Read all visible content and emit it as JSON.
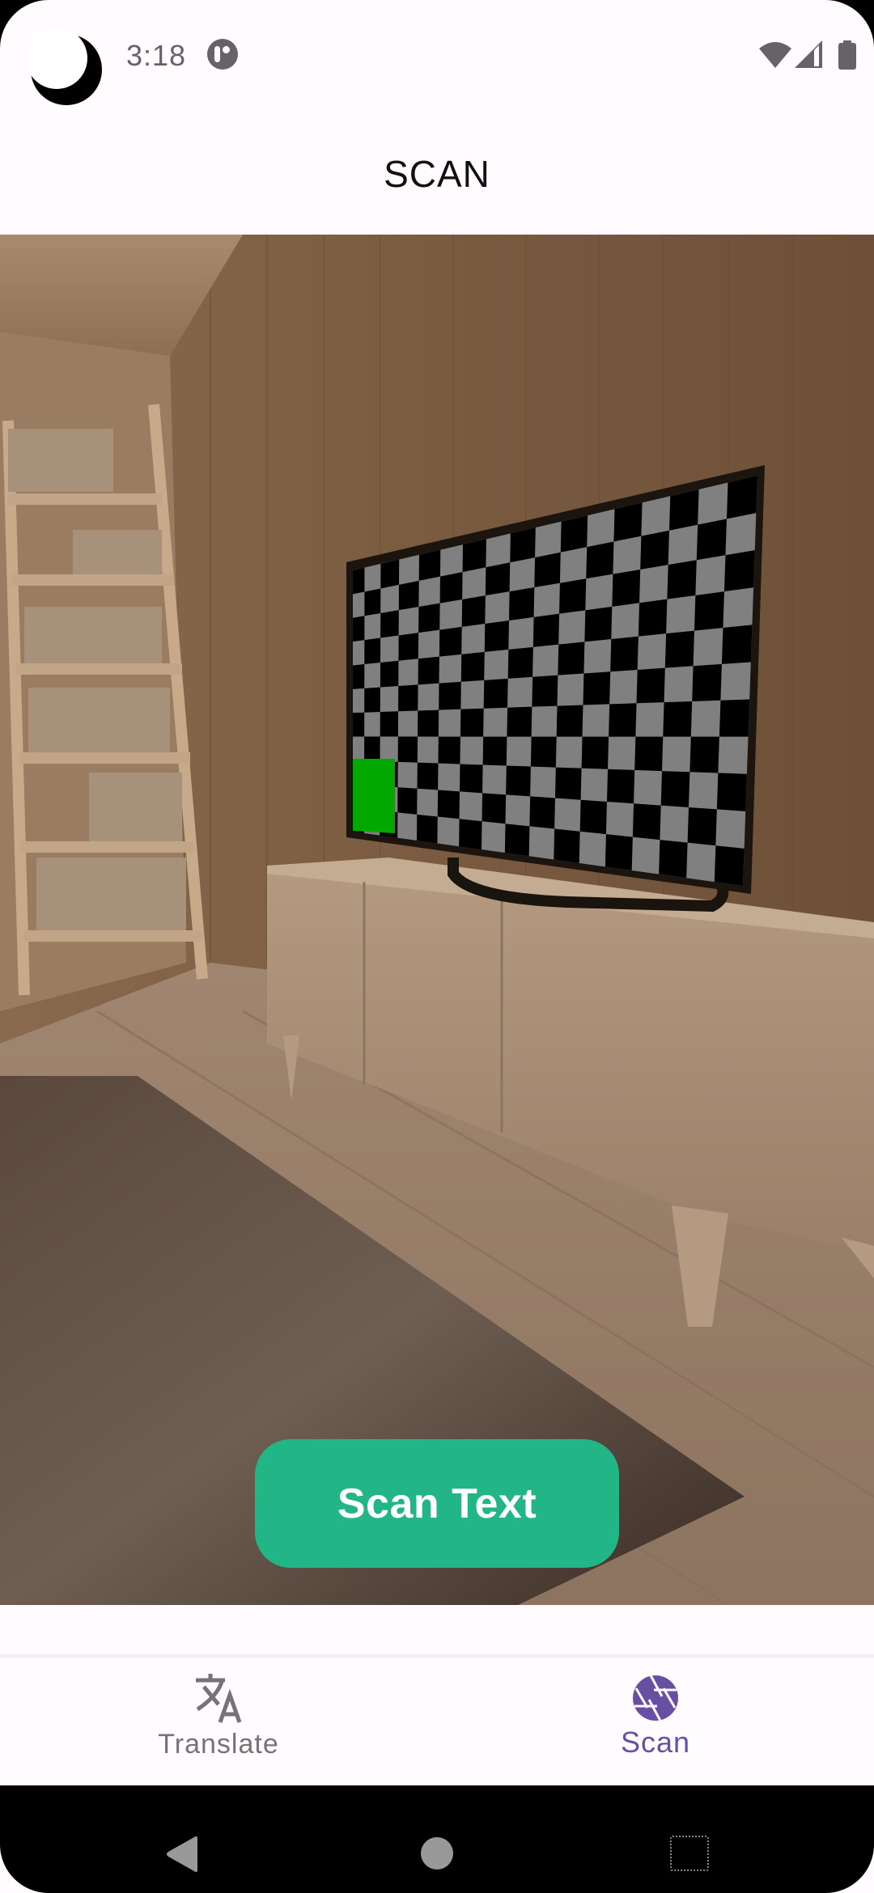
{
  "status_bar": {
    "time": "3:18",
    "icons": [
      "moon-icon",
      "notification-app-icon",
      "wifi-icon",
      "cellular-signal-icon",
      "battery-icon"
    ]
  },
  "app_bar": {
    "title": "SCAN"
  },
  "preview": {
    "description": "Camera preview of a living room with a TV displaying a checkerboard pattern",
    "checkerboard_colors": {
      "dark": "#000000",
      "light": "#808080",
      "marker": "#00a800"
    }
  },
  "scan_button": {
    "label": "Scan Text",
    "color": "#22b585"
  },
  "bottom_nav": {
    "items": [
      {
        "label": "Translate",
        "icon": "translate-icon",
        "selected": false
      },
      {
        "label": "Scan",
        "icon": "camera-shutter-icon",
        "selected": true
      }
    ],
    "active_color": "#6750a4",
    "inactive_color": "#767276"
  },
  "system_nav": {
    "buttons": [
      "back",
      "home",
      "recents"
    ]
  }
}
